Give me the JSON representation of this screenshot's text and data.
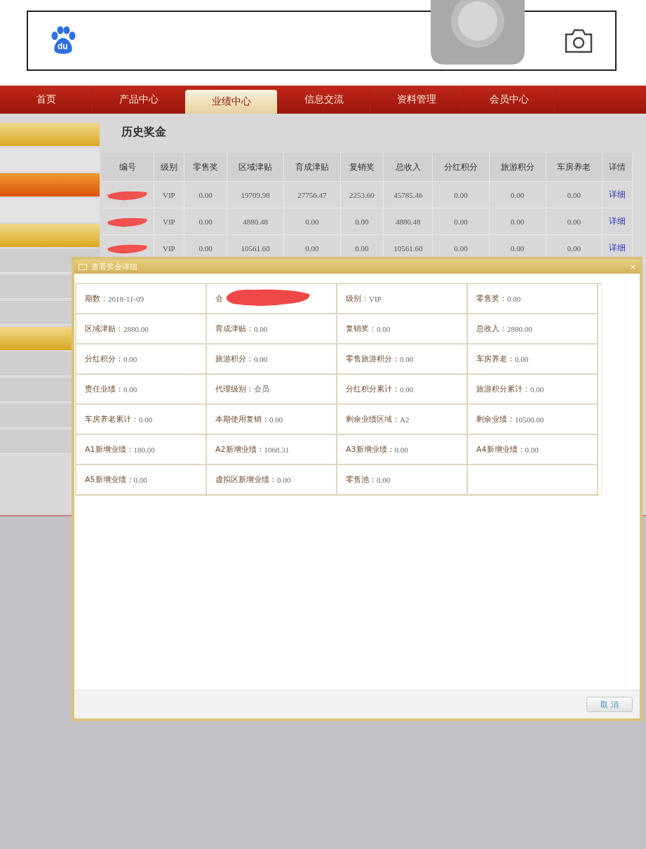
{
  "search_bar": {
    "logo_text": "du"
  },
  "nav": {
    "tabs": [
      {
        "label": "首页",
        "selected": false
      },
      {
        "label": "产品中心",
        "selected": false
      },
      {
        "label": "业绩中心",
        "selected": true
      },
      {
        "label": "信息交流",
        "selected": false
      },
      {
        "label": "资料管理",
        "selected": false
      },
      {
        "label": "会员中心",
        "selected": false
      }
    ]
  },
  "page_title": "历史奖金",
  "table": {
    "columns": [
      "编号",
      "级别",
      "零售奖",
      "区域津贴",
      "育成津贴",
      "复销奖",
      "总收入",
      "分红积分",
      "旅游积分",
      "车房养老",
      "详情"
    ],
    "rows": [
      {
        "redacted": true,
        "cells": [
          "",
          "VIP",
          "0.00",
          "19709.98",
          "27756.47",
          "2253.60",
          "45785.46",
          "0.00",
          "0.00",
          "0.00"
        ],
        "link": "详细"
      },
      {
        "redacted": true,
        "cells": [
          "",
          "VIP",
          "0.00",
          "4880.48",
          "0.00",
          "0.00",
          "4880.48",
          "0.00",
          "0.00",
          "0.00"
        ],
        "link": "详细"
      },
      {
        "redacted": true,
        "cells": [
          "",
          "VIP",
          "0.00",
          "10561.60",
          "0.00",
          "0.00",
          "10561.60",
          "0.00",
          "0.00",
          "0.00"
        ],
        "link": "详细"
      }
    ]
  },
  "dialog": {
    "title": "查看奖金详细",
    "close": "×",
    "fields": [
      {
        "label": "期数：",
        "value": "2018-11-09",
        "redacted": false
      },
      {
        "label": "会",
        "redacted": true
      },
      {
        "label": "级别：",
        "value": "VIP",
        "redacted": false
      },
      {
        "label": "零售奖：",
        "value": "0.00",
        "redacted": false
      },
      {
        "label": "区域津贴：",
        "value": "2880.00",
        "redacted": false
      },
      {
        "label": "育成津贴：",
        "value": "0.00",
        "redacted": false
      },
      {
        "label": "复销奖：",
        "value": "0.00",
        "redacted": false
      },
      {
        "label": "总收入：",
        "value": "2880.00",
        "redacted": false
      },
      {
        "label": "分红积分：",
        "value": "0.00",
        "redacted": false
      },
      {
        "label": "旅游积分：",
        "value": "0.00",
        "redacted": false
      },
      {
        "label": "零售旅游积分：",
        "value": "0.00",
        "redacted": false
      },
      {
        "label": "车房养老：",
        "value": "0.00",
        "redacted": false
      },
      {
        "label": "责任业绩：",
        "value": "0.00",
        "redacted": false
      },
      {
        "label": "代理级别：",
        "value": "会员",
        "redacted": false
      },
      {
        "label": "分红积分累计：",
        "value": "0.00",
        "redacted": false
      },
      {
        "label": "旅游积分累计：",
        "value": "0.00",
        "redacted": false
      },
      {
        "label": "车房养老累计：",
        "value": "0.00",
        "redacted": false
      },
      {
        "label": "本期使用复销：",
        "value": "0.00",
        "redacted": false
      },
      {
        "label": "剩余业绩区域：",
        "value": "A2",
        "redacted": false
      },
      {
        "label": "剩余业绩：",
        "value": "10500.00",
        "redacted": false
      },
      {
        "label": "A1新增业绩：",
        "value": "180.00",
        "redacted": false
      },
      {
        "label": "A2新增业绩：",
        "value": "1068.31",
        "redacted": false
      },
      {
        "label": "A3新增业绩：",
        "value": "0.00",
        "redacted": false
      },
      {
        "label": "A4新增业绩：",
        "value": "0.00",
        "redacted": false
      },
      {
        "label": "A5新增业绩：",
        "value": "0.00",
        "redacted": false
      },
      {
        "label": "虚拟区新增业绩：",
        "value": "0.00",
        "redacted": false
      },
      {
        "label": "零售池：",
        "value": "0.00",
        "redacted": false
      }
    ],
    "cancel_button": "取 消"
  }
}
